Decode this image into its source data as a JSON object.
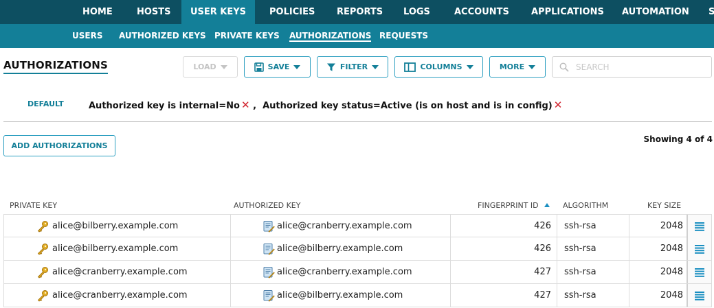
{
  "top_nav": [
    "HOME",
    "HOSTS",
    "USER KEYS",
    "POLICIES",
    "REPORTS",
    "LOGS",
    "ACCOUNTS",
    "APPLICATIONS",
    "AUTOMATION",
    "S"
  ],
  "sub_nav": [
    "USERS",
    "AUTHORIZED KEYS",
    "PRIVATE KEYS",
    "AUTHORIZATIONS",
    "REQUESTS"
  ],
  "page_title": "AUTHORIZATIONS",
  "toolbar": {
    "load": "LOAD",
    "save": "SAVE",
    "filter": "FILTER",
    "columns": "COLUMNS",
    "more": "MORE",
    "search_placeholder": "SEARCH"
  },
  "filters": {
    "preset": "DEFAULT",
    "first": "Authorized key is internal=No",
    "separator": " ,  ",
    "second": "Authorized key status=Active (is on host and is in config)",
    "remove": "✕"
  },
  "actions": {
    "add": "ADD AUTHORIZATIONS"
  },
  "showing": "Showing 4 of 4",
  "table": {
    "headers": {
      "private_key": "PRIVATE KEY",
      "authorized_key": "AUTHORIZED KEY",
      "fingerprint_id": "FINGERPRINT ID",
      "algorithm": "ALGORITHM",
      "key_size": "KEY SIZE"
    },
    "rows": [
      {
        "private_key": "alice@bilberry.example.com",
        "authorized_key": "alice@cranberry.example.com",
        "fingerprint_id": "426",
        "algorithm": "ssh-rsa",
        "key_size": "2048"
      },
      {
        "private_key": "alice@bilberry.example.com",
        "authorized_key": "alice@bilberry.example.com",
        "fingerprint_id": "426",
        "algorithm": "ssh-rsa",
        "key_size": "2048"
      },
      {
        "private_key": "alice@cranberry.example.com",
        "authorized_key": "alice@cranberry.example.com",
        "fingerprint_id": "427",
        "algorithm": "ssh-rsa",
        "key_size": "2048"
      },
      {
        "private_key": "alice@cranberry.example.com",
        "authorized_key": "alice@bilberry.example.com",
        "fingerprint_id": "427",
        "algorithm": "ssh-rsa",
        "key_size": "2048"
      }
    ]
  },
  "colors": {
    "nav_dark": "#0d4f61",
    "nav_teal": "#137f98",
    "accent_blue": "#1a8fc1",
    "remove_red": "#d01f2a",
    "key_gold": "#d9a21b"
  }
}
